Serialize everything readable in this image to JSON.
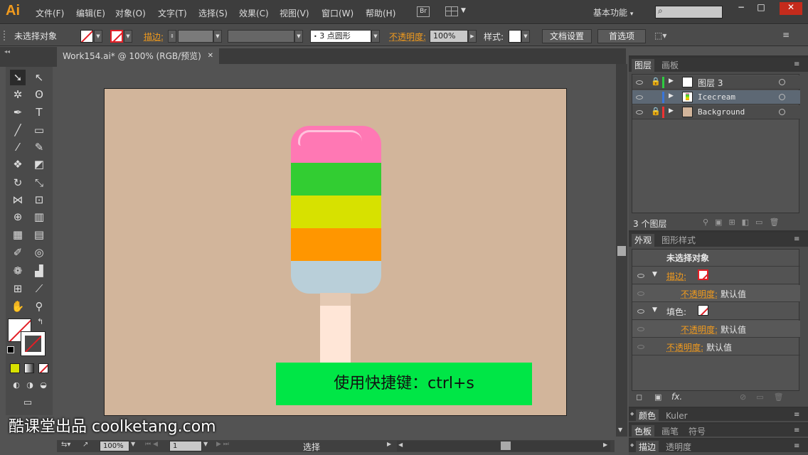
{
  "app": {
    "logo": "Ai"
  },
  "menu": [
    "文件(F)",
    "编辑(E)",
    "对象(O)",
    "文字(T)",
    "选择(S)",
    "效果(C)",
    "视图(V)",
    "窗口(W)",
    "帮助(H)"
  ],
  "menubar": {
    "bridge": "Br",
    "workspace": "基本功能",
    "workspace_arrow": "▾",
    "search_icon": "⌕"
  },
  "window_controls": {
    "minimize": "−",
    "maximize": "□",
    "close": "✕"
  },
  "control": {
    "selection": "未选择对象",
    "stroke_label": "描边:",
    "brush": "3 点圆形",
    "opacity_label": "不透明度:",
    "opacity_value": "100%",
    "style_label": "样式:",
    "doc_setup": "文档设置",
    "prefs": "首选项"
  },
  "document": {
    "tab_title": "Work154.ai* @ 100% (RGB/预览)",
    "close": "✕"
  },
  "overlay_caption": "使用快捷键：ctrl+s",
  "watermark": "酷课堂出品 coolketang.com",
  "colors": {
    "artboard": "#d2b59b",
    "caption_bg": "#00e646",
    "accent": "#f29b1d"
  },
  "icecream": {
    "stripes": [
      {
        "color": "#ff78b4"
      },
      {
        "color": "#32cd32"
      },
      {
        "color": "#d7e100"
      },
      {
        "color": "#ff9600"
      },
      {
        "color": "#b9cfd9"
      }
    ],
    "stick": "#ffe6d7"
  },
  "layers_panel": {
    "tabs": [
      "图层",
      "画板"
    ],
    "layers": [
      {
        "name": "图层 3",
        "color": "#2ecc40",
        "locked": true
      },
      {
        "name": "Icecream",
        "color": "#3a76d9",
        "locked": false,
        "selected": true
      },
      {
        "name": "Background",
        "color": "#e33",
        "locked": true
      }
    ],
    "count": "3 个图层"
  },
  "appearance_panel": {
    "tabs": [
      "外观",
      "图形样式"
    ],
    "title": "未选择对象",
    "stroke": "描边:",
    "fill": "填色:",
    "opacity": "不透明度:",
    "default": "默认值",
    "fx": "fx."
  },
  "collapsed_panels": [
    [
      "颜色",
      "Kuler"
    ],
    [
      "色板",
      "画笔",
      "符号"
    ],
    [
      "描边",
      "透明度"
    ]
  ],
  "status": {
    "zoom": "100%",
    "page": "1",
    "tool": "选择"
  }
}
